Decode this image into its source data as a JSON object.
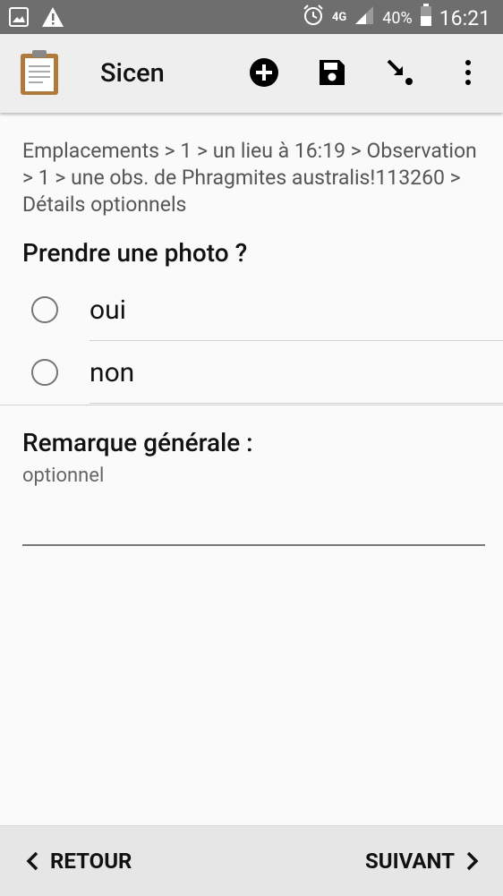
{
  "status_bar": {
    "network": "4G",
    "battery": "40%",
    "time": "16:21",
    "icons": [
      "gallery-icon",
      "warning-icon",
      "alarm-icon",
      "signal-icon",
      "battery-icon"
    ]
  },
  "app_bar": {
    "title": "Sicen",
    "actions": [
      "add-icon",
      "save-icon",
      "arrow-icon",
      "more-icon"
    ]
  },
  "breadcrumb": "Emplacements > 1 > un lieu à 16:19 > Observation > 1 > une obs. de Phragmites australis!113260 > Détails optionnels",
  "question_photo": {
    "label": "Prendre une photo ?",
    "options": [
      "oui",
      "non"
    ]
  },
  "question_remark": {
    "label": "Remarque générale :",
    "hint": "optionnel",
    "value": ""
  },
  "bottom_nav": {
    "back_label": "RETOUR",
    "next_label": "SUIVANT"
  }
}
